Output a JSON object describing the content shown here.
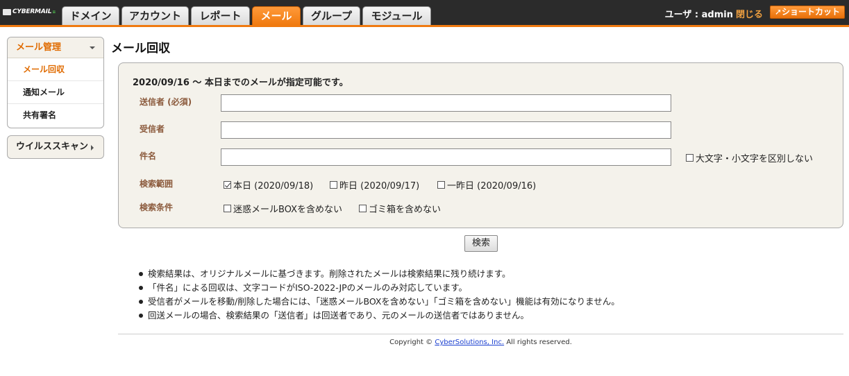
{
  "header": {
    "logo_text": "CYBERMAIL",
    "tabs": [
      {
        "label": "ドメイン"
      },
      {
        "label": "アカウント"
      },
      {
        "label": "レポート"
      },
      {
        "label": "メール",
        "active": true
      },
      {
        "label": "グループ"
      },
      {
        "label": "モジュール"
      }
    ],
    "user_label": "ユーザ : admin",
    "close_label": "閉じる",
    "shortcut_label": "ショートカット",
    "accent_color": "#f07a10"
  },
  "sidebar": {
    "section_title": "メール管理",
    "items": [
      {
        "label": "メール回収",
        "active": true
      },
      {
        "label": "通知メール"
      },
      {
        "label": "共有署名"
      }
    ],
    "virus_label": "ウイルススキャン"
  },
  "main": {
    "title": "メール回収",
    "notice": "2020/09/16 ～ 本日までのメールが指定可能です。",
    "fields": {
      "sender_label": "送信者 (必須)",
      "sender_value": "",
      "recipient_label": "受信者",
      "recipient_value": "",
      "subject_label": "件名",
      "subject_value": "",
      "case_option": "大文字・小文字を区別しない"
    },
    "range_label": "検索範囲",
    "range_options": [
      {
        "label": "本日 (2020/09/18)",
        "checked": true
      },
      {
        "label": "昨日 (2020/09/17)",
        "checked": false
      },
      {
        "label": "一昨日 (2020/09/16)",
        "checked": false
      }
    ],
    "condition_label": "検索条件",
    "condition_options": [
      {
        "label": "迷惑メールBOXを含めない",
        "checked": false
      },
      {
        "label": "ゴミ箱を含めない",
        "checked": false
      }
    ],
    "search_button": "検索",
    "notes": [
      "検索結果は、オリジナルメールに基づきます。削除されたメールは検索結果に残り続けます。",
      "「件名」による回収は、文字コードがISO-2022-JPのメールのみ対応しています。",
      "受信者がメールを移動/削除した場合には、「迷惑メールBOXを含めない」「ゴミ箱を含めない」機能は有効になりません。",
      "回送メールの場合、検索結果の「送信者」は回送者であり、元のメールの送信者ではありません。"
    ]
  },
  "footer": {
    "prefix": "Copyright ©",
    "company": "CyberSolutions, Inc.",
    "suffix": "All rights reserved."
  }
}
